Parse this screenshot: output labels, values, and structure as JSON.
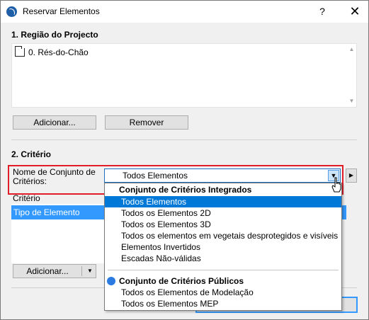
{
  "window": {
    "title": "Reservar Elementos",
    "help_label": "?",
    "close_label": "✕"
  },
  "region": {
    "title": "1. Região do Projecto",
    "items": [
      "0. Rés-do-Chão"
    ],
    "add_label": "Adicionar...",
    "remove_label": "Remover"
  },
  "criteria": {
    "title": "2. Critério",
    "set_label": "Nome de Conjunto de Critérios:",
    "selected_value": "Todos Elementos",
    "column_header": "Critério",
    "rows": [
      "Tipo de Elemento"
    ],
    "add_label": "Adicionar..."
  },
  "dropdown": {
    "group_integrated": "Conjunto de Critérios Integrados",
    "integrated_items": [
      "Todos Elementos",
      "Todos os Elementos 2D",
      "Todos os Elementos 3D",
      "Todos os elementos em vegetais desprotegidos e visíveis",
      "Elementos Invertidos",
      "Escadas Não-válidas"
    ],
    "group_public": "Conjunto de Critérios Públicos",
    "public_items": [
      "Todos os Elementos de Modelação",
      "Todos os Elementos MEP"
    ],
    "selected_index": 0
  },
  "colors": {
    "highlight": "#e11d2a",
    "selection": "#0078d7",
    "public_dot": "#2a7ae2"
  }
}
